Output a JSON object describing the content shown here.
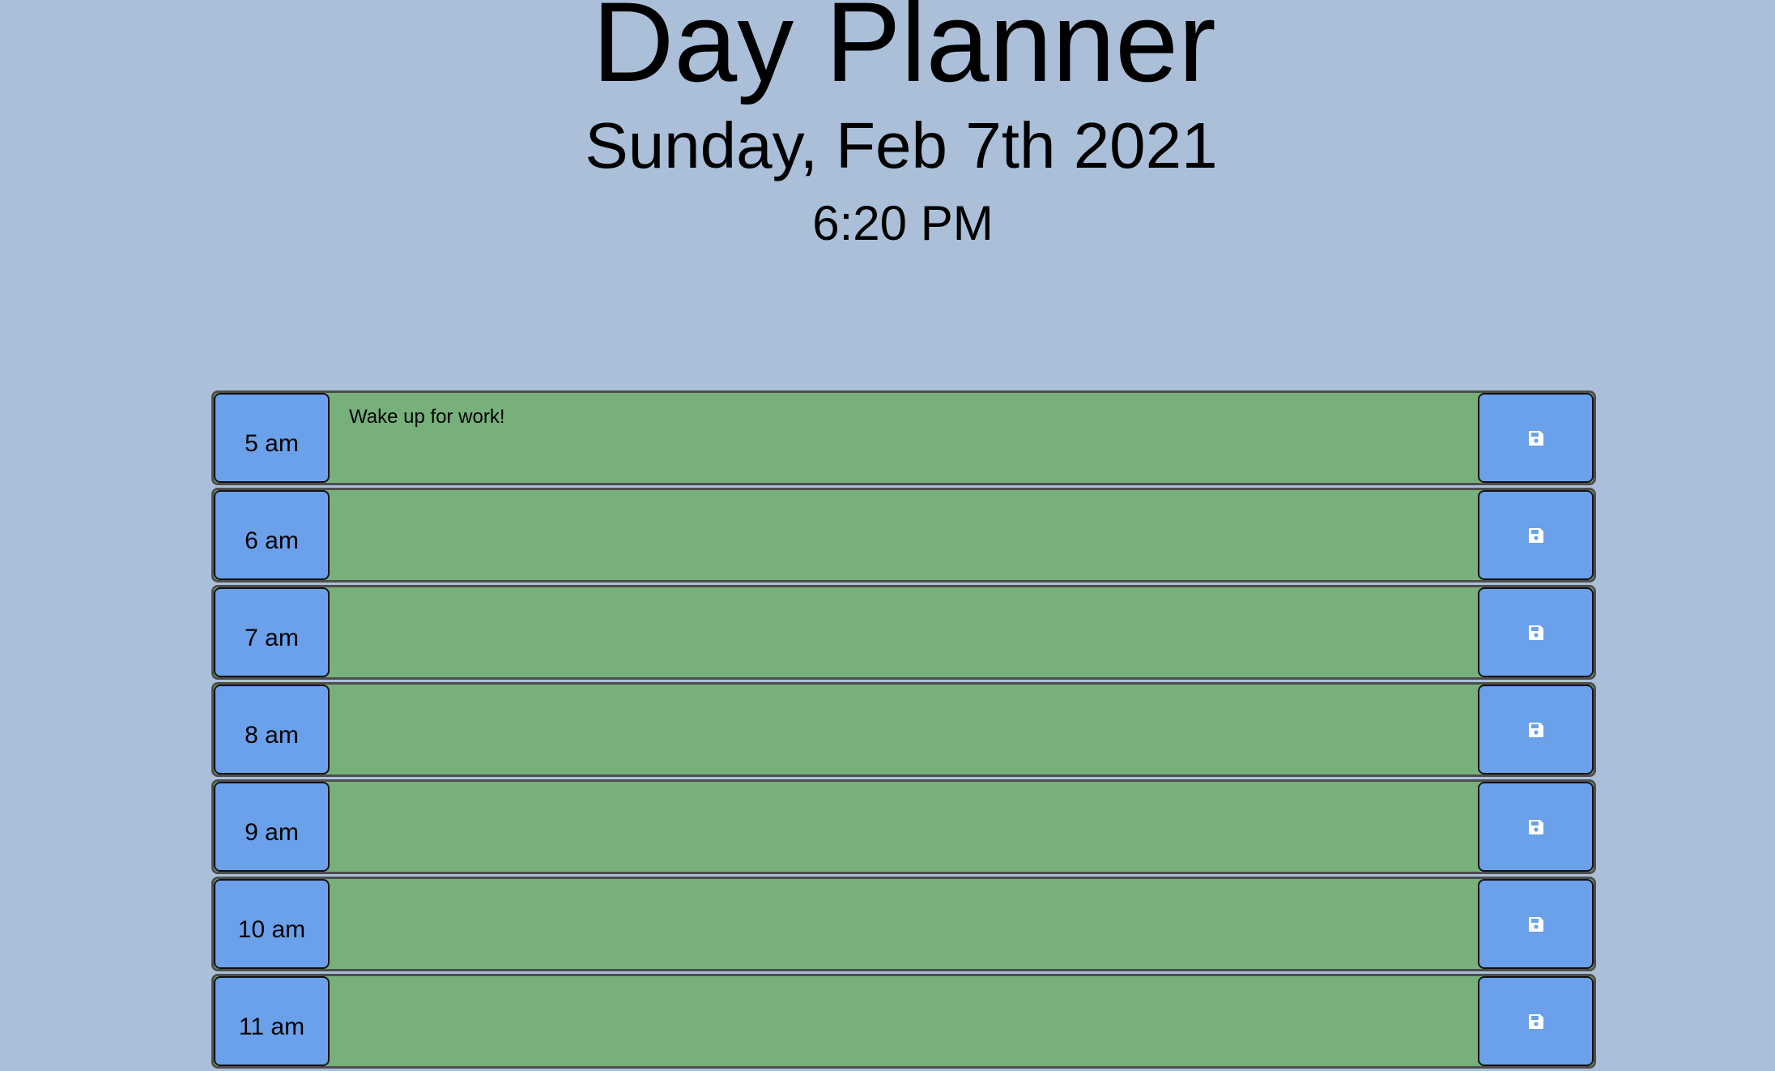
{
  "header": {
    "title": "Day Planner",
    "date": "Sunday, Feb 7th 2021",
    "time": "6:20 PM"
  },
  "colors": {
    "background": "#abbfd9",
    "present_row": "#77b07b",
    "hour_block": "#6aa1ea",
    "save_button": "#6aa1ea",
    "save_icon": "#ffffff"
  },
  "rows": [
    {
      "hour": "5 am",
      "task": "Wake up for work!",
      "icon": "save-icon"
    },
    {
      "hour": "6 am",
      "task": "",
      "icon": "save-icon"
    },
    {
      "hour": "7 am",
      "task": "",
      "icon": "save-icon"
    },
    {
      "hour": "8 am",
      "task": "",
      "icon": "save-icon"
    },
    {
      "hour": "9 am",
      "task": "",
      "icon": "save-icon"
    },
    {
      "hour": "10 am",
      "task": "",
      "icon": "save-icon"
    },
    {
      "hour": "11 am",
      "task": "",
      "icon": "save-icon"
    }
  ]
}
